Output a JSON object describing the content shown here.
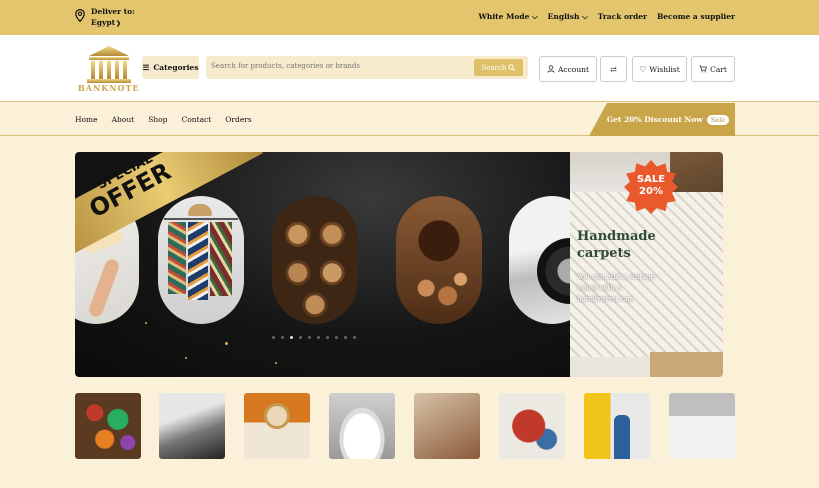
{
  "topbar": {
    "deliver_label": "Deliver to:",
    "deliver_country": "Egypt",
    "theme": "White Mode",
    "language": "English",
    "track_order": "Track order",
    "become_supplier": "Become a supplier"
  },
  "header": {
    "logo_text": "BANKNOTE",
    "categories_label": "Categories",
    "search_placeholder": "Search for products, categories or brands",
    "search_button": "Search",
    "account_label": "Account",
    "wishlist_label": "Wishlist",
    "cart_label": "Cart"
  },
  "nav": {
    "links": [
      "Home",
      "About",
      "Shop",
      "Contact",
      "Orders"
    ],
    "promo_text": "Get 20% Discount Now",
    "promo_badge": "Sale"
  },
  "hero": {
    "ribbon_small": "SPECIAL",
    "ribbon_big": "OFFER",
    "slide_images": [
      "painting",
      "clothes-rack",
      "firewood",
      "tea-spices",
      "car-tire"
    ],
    "active_dot": 3,
    "dot_count": 10
  },
  "side_banner": {
    "badge_line1": "SALE",
    "badge_line2": "20%",
    "title_line1": "Handmade",
    "title_line2": "carpets",
    "subtitle": "You can add a vintage touch with a handwoven rug."
  },
  "categories_thumbs": [
    "groceries",
    "car-parts",
    "home-decor",
    "tableware",
    "kitchen",
    "fashion",
    "painting",
    "mattress"
  ],
  "colors": {
    "gold": "#e3c56e",
    "cream": "#fbf1d8",
    "dark_gold": "#c9a54a",
    "sale_orange": "#e9592c"
  }
}
